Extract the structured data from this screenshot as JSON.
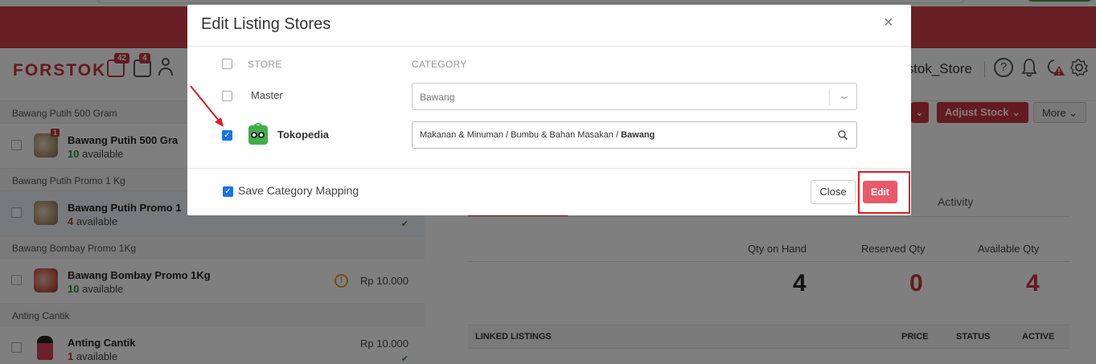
{
  "app": {
    "logo": "FORSTOK",
    "badges": {
      "orders": "42",
      "inventory": "4"
    },
    "store_name": "rstok_Store",
    "help_glyph": "?"
  },
  "products": {
    "groups": [
      {
        "header": "Bawang Putih 500 Gram",
        "name": "Bawang Putih 500 Gra",
        "available_count": "10",
        "available_label": "available",
        "badge": "1",
        "price": ""
      },
      {
        "header": "Bawang Putih Promo 1 Kg",
        "name": "Bawang Putih Promo 1",
        "available_count": "4",
        "available_label": "available",
        "price": "",
        "check": "✔"
      },
      {
        "header": "Bawang Bombay Promo 1Kg",
        "name": "Bawang Bombay Promo 1Kg",
        "available_count": "10",
        "available_label": "available",
        "price": "Rp 10.000",
        "warn": "!"
      },
      {
        "header": "Anting Cantik",
        "name": "Anting Cantik",
        "available_count": "1",
        "available_label": "available",
        "price": "Rp 10.000",
        "check": "✔"
      }
    ]
  },
  "detail": {
    "buttons": {
      "adjust_stock": "Adjust Stock",
      "more": "More"
    },
    "tabs": {
      "activity": "Activity"
    },
    "qty": {
      "on_hand_label": "Qty on Hand",
      "on_hand": "4",
      "reserved_label": "Reserved Qty",
      "reserved": "0",
      "available_label": "Available Qty",
      "available": "4"
    },
    "linked": {
      "title": "LINKED LISTINGS",
      "price": "PRICE",
      "status": "STATUS",
      "active": "ACTIVE"
    }
  },
  "modal": {
    "title": "Edit Listing Stores",
    "close_glyph": "×",
    "columns": {
      "store": "STORE",
      "category": "CATEGORY"
    },
    "rows": [
      {
        "store": "Master",
        "category": "Bawang",
        "checked": false
      },
      {
        "store": "Tokopedia",
        "category_path": "Makanan & Minuman / Bumbu & Bahan Masakan / ",
        "category_leaf": "Bawang",
        "checked": true
      }
    ],
    "save_mapping_label": "Save Category Mapping",
    "save_mapping_checked": true,
    "buttons": {
      "close": "Close",
      "edit": "Edit"
    }
  },
  "icons": {
    "close": "close-icon",
    "search": "search-icon",
    "chevron": "chevron-down-icon",
    "help": "help-icon",
    "bell": "bell-icon",
    "settings": "gear-icon",
    "user": "user-icon"
  },
  "colors": {
    "brand_red": "#c9343d",
    "edit_button": "#e85a6a",
    "checkbox_blue": "#1a73e8",
    "available_green": "#2e8b3d",
    "annotation_red": "#e01b24"
  }
}
